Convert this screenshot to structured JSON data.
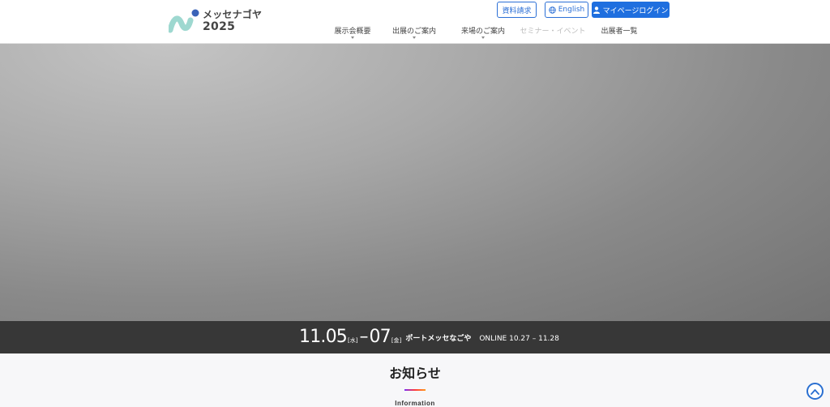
{
  "logo": {
    "name": "メッセナゴヤ",
    "year": "2025"
  },
  "top_actions": {
    "document_request": "資料請求",
    "english": "English",
    "login": "マイページログイン"
  },
  "nav": [
    {
      "label": "展示会概要"
    },
    {
      "label": "出展のご案内"
    },
    {
      "label": "来場のご案内"
    },
    {
      "label": "セミナー・イベント"
    },
    {
      "label": "出展者一覧"
    }
  ],
  "event": {
    "start_date": "11.05",
    "start_day": "[水]",
    "end_date": "07",
    "end_day": "[金]",
    "venue": "ポートメッセなごや",
    "online": "ONLINE 10.27 – 11.28"
  },
  "info": {
    "title": "お知らせ",
    "subtitle": "Information"
  },
  "icons": {
    "globe": "globe-icon",
    "user": "user-icon",
    "scroll_top": "chevron-up-icon"
  },
  "colors": {
    "accent": "#1f6fdf",
    "logo_blue": "#3a63b8",
    "logo_teal": "#9ed8d0"
  }
}
